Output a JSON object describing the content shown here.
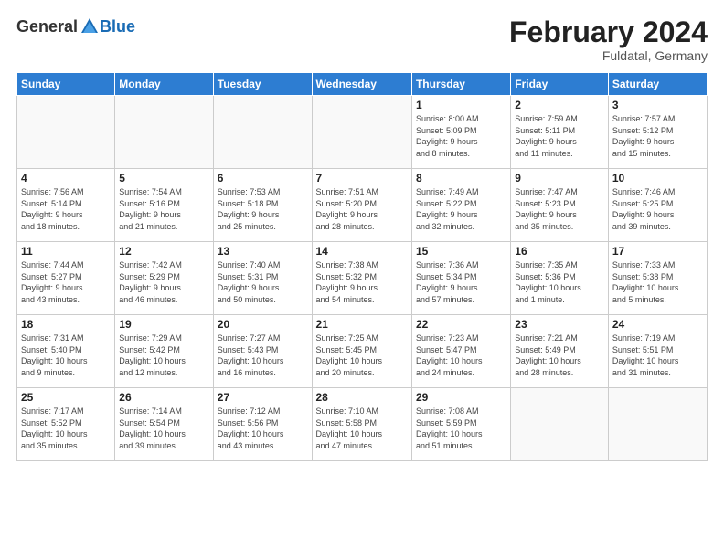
{
  "header": {
    "logo_general": "General",
    "logo_blue": "Blue",
    "title": "February 2024",
    "subtitle": "Fuldatal, Germany"
  },
  "days_of_week": [
    "Sunday",
    "Monday",
    "Tuesday",
    "Wednesday",
    "Thursday",
    "Friday",
    "Saturday"
  ],
  "weeks": [
    [
      {
        "day": "",
        "info": ""
      },
      {
        "day": "",
        "info": ""
      },
      {
        "day": "",
        "info": ""
      },
      {
        "day": "",
        "info": ""
      },
      {
        "day": "1",
        "info": "Sunrise: 8:00 AM\nSunset: 5:09 PM\nDaylight: 9 hours\nand 8 minutes."
      },
      {
        "day": "2",
        "info": "Sunrise: 7:59 AM\nSunset: 5:11 PM\nDaylight: 9 hours\nand 11 minutes."
      },
      {
        "day": "3",
        "info": "Sunrise: 7:57 AM\nSunset: 5:12 PM\nDaylight: 9 hours\nand 15 minutes."
      }
    ],
    [
      {
        "day": "4",
        "info": "Sunrise: 7:56 AM\nSunset: 5:14 PM\nDaylight: 9 hours\nand 18 minutes."
      },
      {
        "day": "5",
        "info": "Sunrise: 7:54 AM\nSunset: 5:16 PM\nDaylight: 9 hours\nand 21 minutes."
      },
      {
        "day": "6",
        "info": "Sunrise: 7:53 AM\nSunset: 5:18 PM\nDaylight: 9 hours\nand 25 minutes."
      },
      {
        "day": "7",
        "info": "Sunrise: 7:51 AM\nSunset: 5:20 PM\nDaylight: 9 hours\nand 28 minutes."
      },
      {
        "day": "8",
        "info": "Sunrise: 7:49 AM\nSunset: 5:22 PM\nDaylight: 9 hours\nand 32 minutes."
      },
      {
        "day": "9",
        "info": "Sunrise: 7:47 AM\nSunset: 5:23 PM\nDaylight: 9 hours\nand 35 minutes."
      },
      {
        "day": "10",
        "info": "Sunrise: 7:46 AM\nSunset: 5:25 PM\nDaylight: 9 hours\nand 39 minutes."
      }
    ],
    [
      {
        "day": "11",
        "info": "Sunrise: 7:44 AM\nSunset: 5:27 PM\nDaylight: 9 hours\nand 43 minutes."
      },
      {
        "day": "12",
        "info": "Sunrise: 7:42 AM\nSunset: 5:29 PM\nDaylight: 9 hours\nand 46 minutes."
      },
      {
        "day": "13",
        "info": "Sunrise: 7:40 AM\nSunset: 5:31 PM\nDaylight: 9 hours\nand 50 minutes."
      },
      {
        "day": "14",
        "info": "Sunrise: 7:38 AM\nSunset: 5:32 PM\nDaylight: 9 hours\nand 54 minutes."
      },
      {
        "day": "15",
        "info": "Sunrise: 7:36 AM\nSunset: 5:34 PM\nDaylight: 9 hours\nand 57 minutes."
      },
      {
        "day": "16",
        "info": "Sunrise: 7:35 AM\nSunset: 5:36 PM\nDaylight: 10 hours\nand 1 minute."
      },
      {
        "day": "17",
        "info": "Sunrise: 7:33 AM\nSunset: 5:38 PM\nDaylight: 10 hours\nand 5 minutes."
      }
    ],
    [
      {
        "day": "18",
        "info": "Sunrise: 7:31 AM\nSunset: 5:40 PM\nDaylight: 10 hours\nand 9 minutes."
      },
      {
        "day": "19",
        "info": "Sunrise: 7:29 AM\nSunset: 5:42 PM\nDaylight: 10 hours\nand 12 minutes."
      },
      {
        "day": "20",
        "info": "Sunrise: 7:27 AM\nSunset: 5:43 PM\nDaylight: 10 hours\nand 16 minutes."
      },
      {
        "day": "21",
        "info": "Sunrise: 7:25 AM\nSunset: 5:45 PM\nDaylight: 10 hours\nand 20 minutes."
      },
      {
        "day": "22",
        "info": "Sunrise: 7:23 AM\nSunset: 5:47 PM\nDaylight: 10 hours\nand 24 minutes."
      },
      {
        "day": "23",
        "info": "Sunrise: 7:21 AM\nSunset: 5:49 PM\nDaylight: 10 hours\nand 28 minutes."
      },
      {
        "day": "24",
        "info": "Sunrise: 7:19 AM\nSunset: 5:51 PM\nDaylight: 10 hours\nand 31 minutes."
      }
    ],
    [
      {
        "day": "25",
        "info": "Sunrise: 7:17 AM\nSunset: 5:52 PM\nDaylight: 10 hours\nand 35 minutes."
      },
      {
        "day": "26",
        "info": "Sunrise: 7:14 AM\nSunset: 5:54 PM\nDaylight: 10 hours\nand 39 minutes."
      },
      {
        "day": "27",
        "info": "Sunrise: 7:12 AM\nSunset: 5:56 PM\nDaylight: 10 hours\nand 43 minutes."
      },
      {
        "day": "28",
        "info": "Sunrise: 7:10 AM\nSunset: 5:58 PM\nDaylight: 10 hours\nand 47 minutes."
      },
      {
        "day": "29",
        "info": "Sunrise: 7:08 AM\nSunset: 5:59 PM\nDaylight: 10 hours\nand 51 minutes."
      },
      {
        "day": "",
        "info": ""
      },
      {
        "day": "",
        "info": ""
      }
    ]
  ]
}
